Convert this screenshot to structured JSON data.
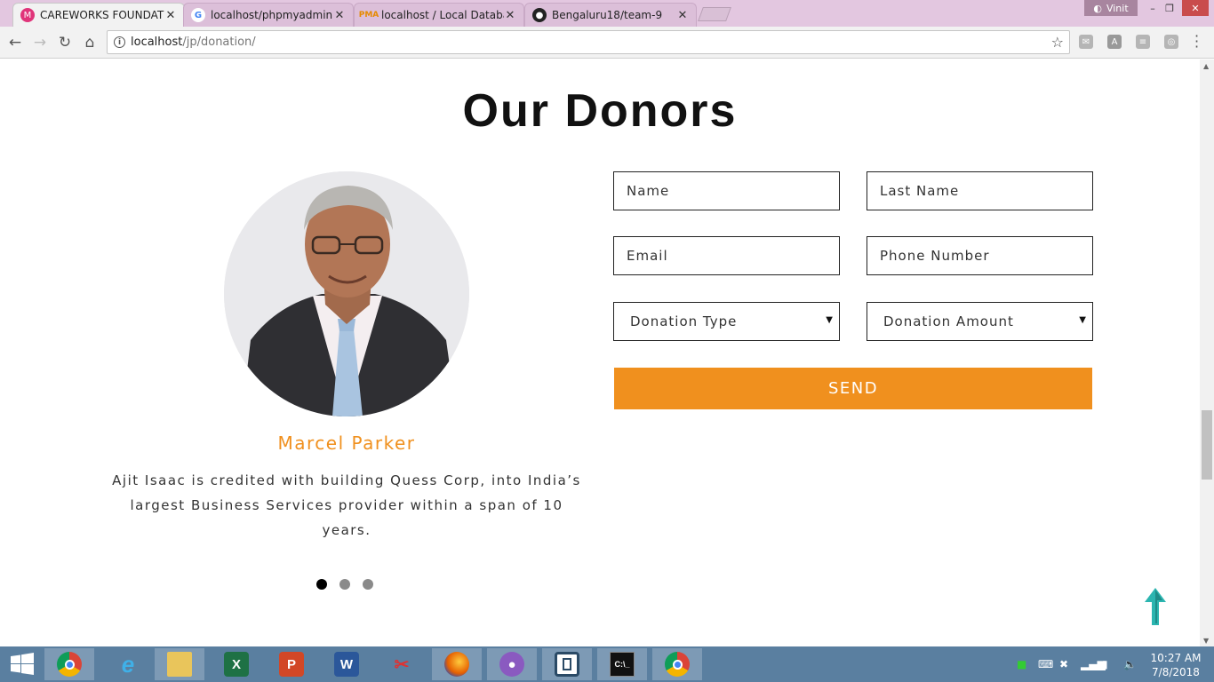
{
  "browser": {
    "tabs": [
      {
        "title": "CAREWORKS FOUNDATIO",
        "active": true
      },
      {
        "title": "localhost/phpmyadmin -",
        "active": false
      },
      {
        "title": "localhost / Local Databas",
        "active": false
      },
      {
        "title": "Bengaluru18/team-9",
        "active": false
      }
    ],
    "profile_name": "Vinit",
    "url_host": "localhost",
    "url_path": "/jp/donation/"
  },
  "page": {
    "heading": "Our Donors",
    "donor": {
      "name": "Marcel Parker",
      "bio": "Ajit Isaac is credited with building Quess Corp, into India’s largest Business Services provider within a span of 10 years."
    },
    "carousel": {
      "count": 3,
      "active_index": 0
    },
    "form": {
      "name_placeholder": "Name",
      "last_name_placeholder": "Last Name",
      "email_placeholder": "Email",
      "phone_placeholder": "Phone Number",
      "donation_type": "Donation Type",
      "donation_amount": "Donation Amount",
      "send_label": "SEND"
    }
  },
  "taskbar": {
    "apps": [
      "start-icon",
      "chrome-icon",
      "internet-explorer-icon",
      "file-explorer-icon",
      "excel-icon",
      "powerpoint-icon",
      "word-icon",
      "snipping-tool-icon",
      "firefox-icon",
      "github-desktop-icon",
      "app-icon",
      "command-prompt-icon",
      "chrome-icon"
    ],
    "clock_time": "10:27 AM",
    "clock_date": "7/8/2018"
  },
  "colors": {
    "accent": "#f0901e",
    "tabstrip": "#e3c7e0",
    "taskbar": "#5a7fa0",
    "scroll_top_arrow": "#2bb5b0"
  }
}
